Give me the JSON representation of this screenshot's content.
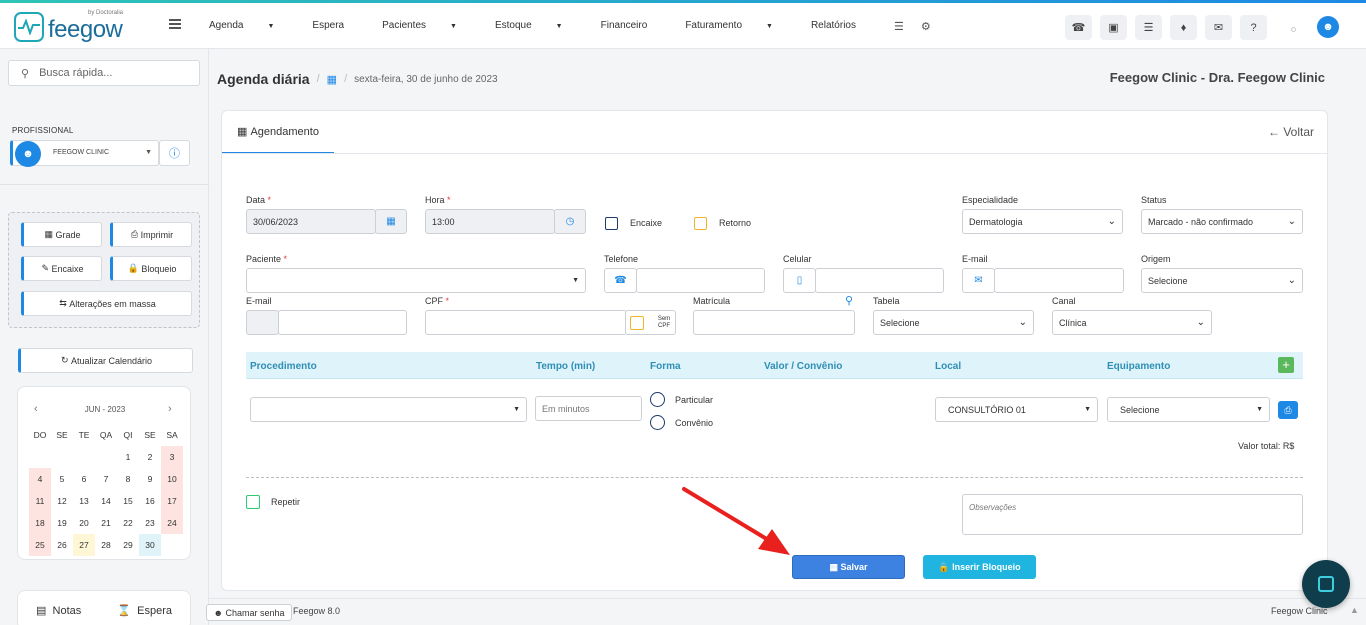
{
  "header": {
    "brand": "feegow",
    "brand_by": "by Doctoralia",
    "nav": [
      {
        "label": "Agenda",
        "dropdown": true
      },
      {
        "label": "Espera",
        "dropdown": false
      },
      {
        "label": "Pacientes",
        "dropdown": true
      },
      {
        "label": "Estoque",
        "dropdown": true
      },
      {
        "label": "Financeiro",
        "dropdown": false
      },
      {
        "label": "Faturamento",
        "dropdown": true
      },
      {
        "label": "Relatórios",
        "dropdown": false
      }
    ],
    "nav_icons": [
      "database-icon",
      "gear-icon"
    ],
    "right_icons": [
      "phone-icon",
      "inbox-icon",
      "tasks-icon",
      "bell-icon",
      "chat-icon",
      "help-icon"
    ]
  },
  "sidebar": {
    "search_placeholder": "Busca rápida...",
    "profissional_label": "PROFISSIONAL",
    "profissional_value": "FEEGOW CLINIC",
    "actions": {
      "grade": "Grade",
      "imprimir": "Imprimir",
      "encaixe": "Encaixe",
      "bloqueio": "Bloqueio",
      "alteracoes": "Alterações em massa"
    },
    "atualizar": "Atualizar Calendário",
    "calendar": {
      "month": "JUN - 2023",
      "days_header": [
        "DO",
        "SE",
        "TE",
        "QA",
        "QI",
        "SE",
        "SA"
      ],
      "weeks": [
        [
          "",
          "",
          "",
          "",
          "1",
          "2",
          "3"
        ],
        [
          "4",
          "5",
          "6",
          "7",
          "8",
          "9",
          "10"
        ],
        [
          "11",
          "12",
          "13",
          "14",
          "15",
          "16",
          "17"
        ],
        [
          "18",
          "19",
          "20",
          "21",
          "22",
          "23",
          "24"
        ],
        [
          "25",
          "26",
          "27",
          "28",
          "29",
          "30",
          ""
        ]
      ],
      "today": "30",
      "highlight": "27"
    },
    "bottom": {
      "notas": "Notas",
      "espera": "Espera"
    }
  },
  "breadcrumb": {
    "title": "Agenda diária",
    "date": "sexta-feira, 30 de junho de 2023"
  },
  "clinic_name": "Feegow Clinic - Dra. Feegow Clinic",
  "form": {
    "tab": "Agendamento",
    "voltar": "Voltar",
    "data_label": "Data",
    "data_value": "30/06/2023",
    "hora_label": "Hora",
    "hora_value": "13:00",
    "encaixe_label": "Encaixe",
    "retorno_label": "Retorno",
    "especialidade_label": "Especialidade",
    "especialidade_value": "Dermatologia",
    "status_label": "Status",
    "status_value": "Marcado - não confirmado",
    "paciente_label": "Paciente",
    "telefone_label": "Telefone",
    "celular_label": "Celular",
    "email_label": "E-mail",
    "origem_label": "Origem",
    "origem_value": "Selecione",
    "email2_label": "E-mail",
    "cpf_label": "CPF",
    "sem_cpf": "Sem CPF",
    "matricula_label": "Matrícula",
    "tabela_label": "Tabela",
    "tabela_value": "Selecione",
    "canal_label": "Canal",
    "canal_value": "Clínica",
    "proc_headers": {
      "procedimento": "Procedimento",
      "tempo": "Tempo (min)",
      "forma": "Forma",
      "valor": "Valor / Convênio",
      "local": "Local",
      "equipamento": "Equipamento"
    },
    "tempo_placeholder": "Em minutos",
    "forma_particular": "Particular",
    "forma_convenio": "Convênio",
    "local_value": "CONSULTÓRIO 01",
    "equipamento_value": "Selecione",
    "valor_total": "Valor total: R$",
    "repetir_label": "Repetir",
    "observacoes_placeholder": "Observações",
    "salvar": "Salvar",
    "inserir_bloqueio": "Inserir Bloqueio"
  },
  "footer": {
    "chamar_senha": "Chamar senha",
    "version": "Feegow 8.0",
    "clinic": "Feegow Clinic"
  },
  "colors": {
    "accent": "#1e88e5",
    "save": "#3d82e0",
    "block": "#1fb5e0",
    "arrow": "#e8201e"
  }
}
